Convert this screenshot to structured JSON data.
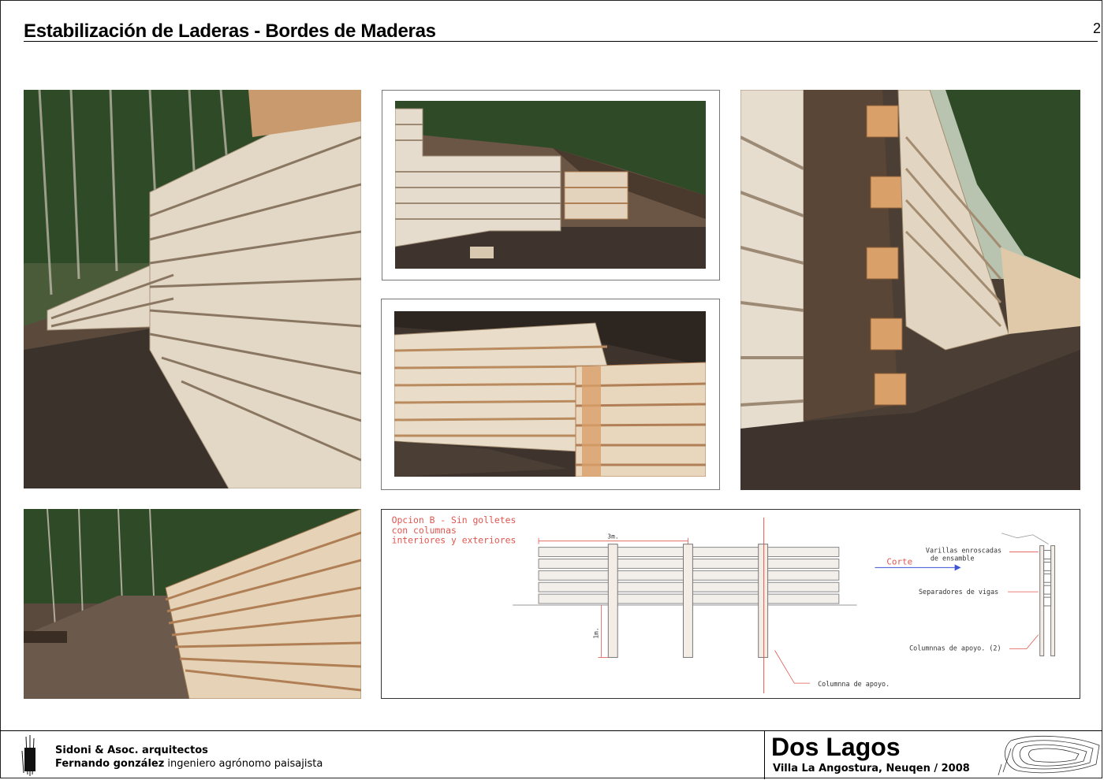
{
  "header": {
    "title": "Estabilización de Laderas - Bordes de Maderas",
    "page_number": "2"
  },
  "photos": [
    {
      "name": "photo-retaining-wall-left"
    },
    {
      "name": "photo-retaining-wall-top-center"
    },
    {
      "name": "photo-retaining-wall-mid-center"
    },
    {
      "name": "photo-retaining-wall-corner"
    },
    {
      "name": "photo-retaining-wall-road"
    }
  ],
  "drawing": {
    "option_title_line1": "Opcion B - Sin golletes",
    "option_title_line2": "con columnas",
    "option_title_line3": "interiores y exteriores",
    "dim_width": "3m.",
    "dim_depth": "1m.",
    "corte_label": "Corte",
    "label_varillas_1": "Varillas enroscadas",
    "label_varillas_2": "de ensamble",
    "label_separadores": "Separadores de vigas",
    "label_columnas_apoyo_2": "Columnnas de apoyo. (2)",
    "label_columna_apoyo": "Columnna de apoyo."
  },
  "footer": {
    "firm_name": "Sidoni & Asoc. arquitectos",
    "person_name": "Fernando gonzález",
    "person_role": " ingeniero agrónomo paisajista",
    "project_name": "Dos Lagos",
    "location_year": "Villa La Angostura, Neuqen / 2008"
  },
  "colors": {
    "wood_light": "#e8dccb",
    "wood_orange": "#d9a06a",
    "forest": "#3e5a2e",
    "soil": "#4a3e35",
    "cad_red": "#e0564f",
    "cad_blue": "#3b55d6"
  }
}
